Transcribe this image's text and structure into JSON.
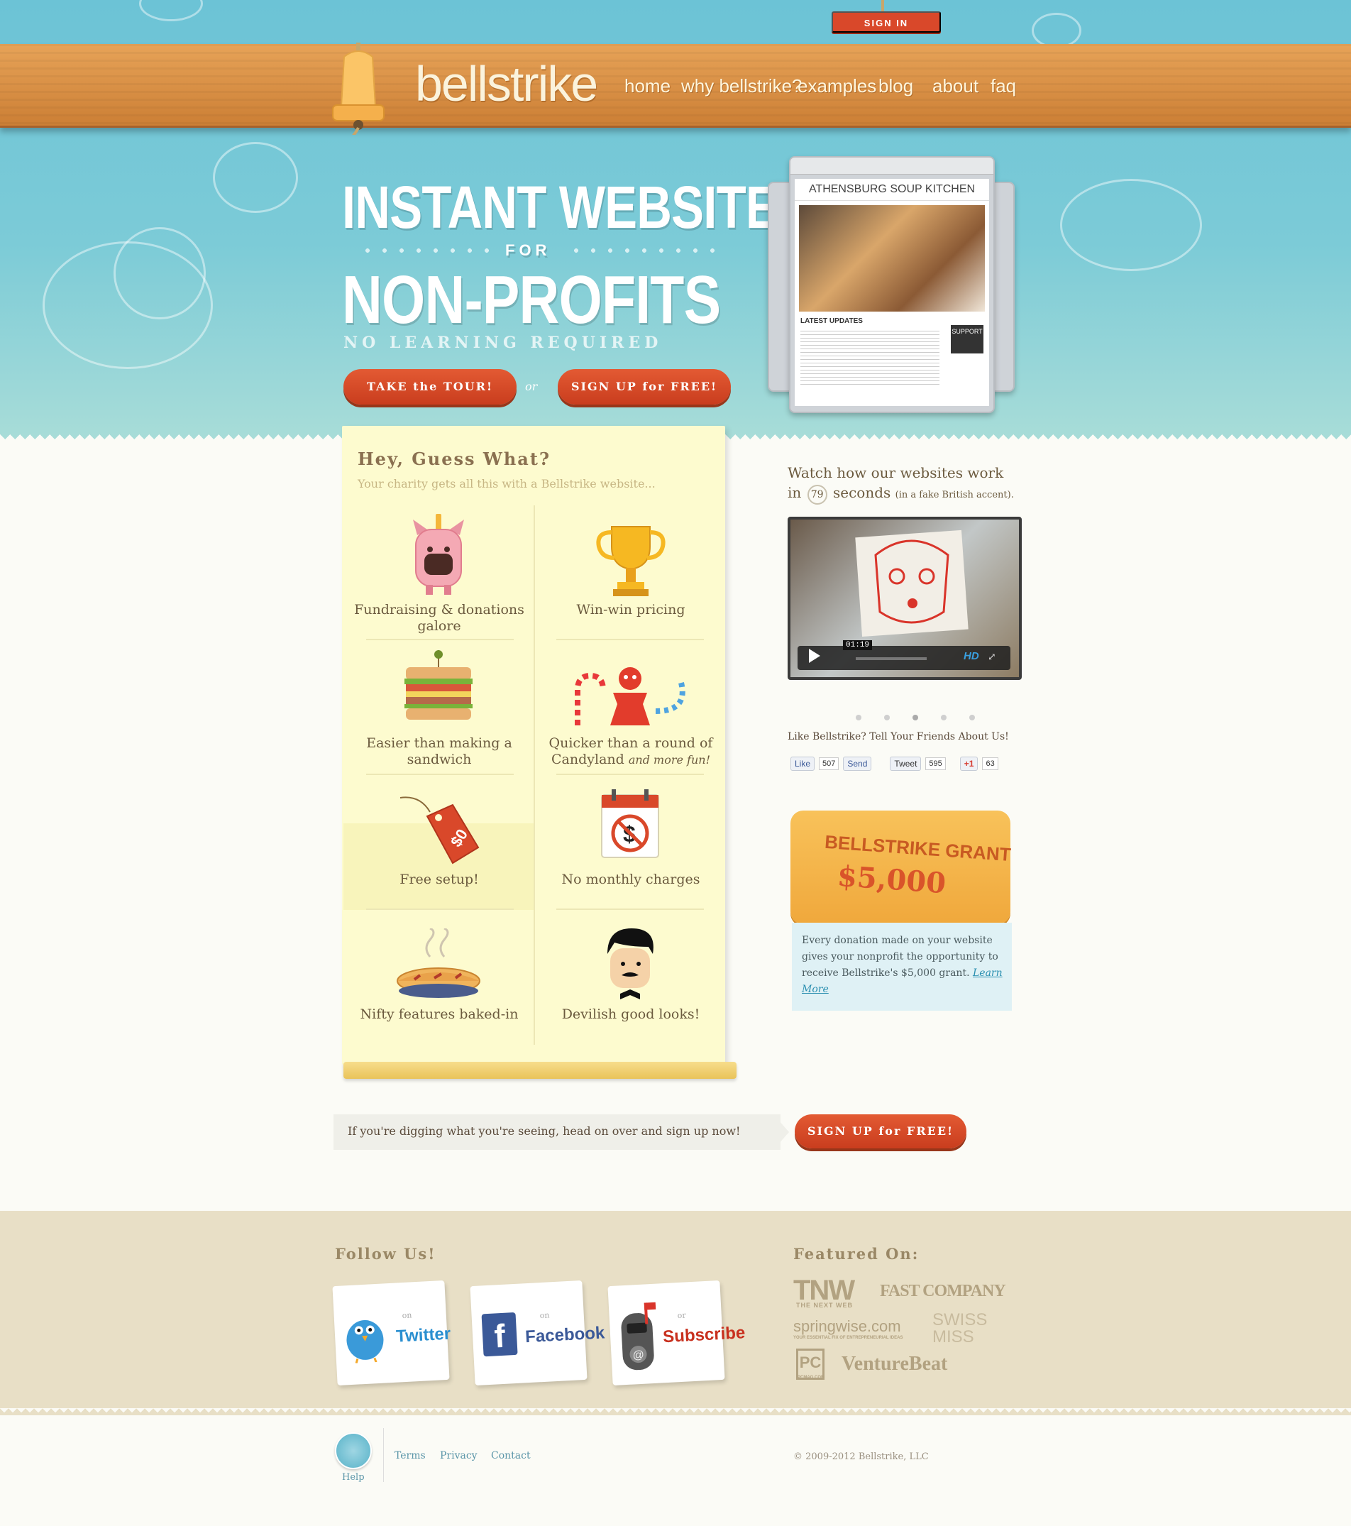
{
  "header": {
    "logo": "bellstrike",
    "nav": [
      "home",
      "why bellstrike?",
      "examples",
      "blog",
      "about",
      "faq"
    ],
    "signin": "SIGN IN"
  },
  "hero": {
    "line1": "INSTANT WEBSITES",
    "for": "FOR",
    "line2": "NON-PROFITS",
    "sub": "NO LEARNING REQUIRED",
    "tour_btn": "TAKE the TOUR!",
    "or": "or",
    "signup_btn": "SIGN UP for FREE!"
  },
  "mock": {
    "title": "ATHENSBURG SOUP KITCHEN",
    "section": "LATEST UPDATES",
    "support": "SUPPORT"
  },
  "features": {
    "title": "Hey, Guess What?",
    "subtitle": "Your charity gets all this with a Bellstrike website...",
    "items": [
      {
        "label": "Fundraising & donations galore",
        "icon": "piggy-bank-icon"
      },
      {
        "label": "Win-win pricing",
        "icon": "trophy-icon"
      },
      {
        "label": "Easier than making a sandwich",
        "icon": "sandwich-icon"
      },
      {
        "label": "Quicker than a round of Candyland",
        "suffix": "and more fun!",
        "icon": "candy-icon"
      },
      {
        "label": "Free setup!",
        "icon": "price-tag-icon"
      },
      {
        "label": "No monthly charges",
        "icon": "no-dollar-calendar-icon"
      },
      {
        "label": "Nifty features baked-in",
        "icon": "pie-icon"
      },
      {
        "label": "Devilish good looks!",
        "icon": "gentleman-icon"
      }
    ]
  },
  "video": {
    "line1": "Watch how our websites work",
    "in": "in",
    "seconds_num": "79",
    "seconds": "seconds",
    "note": "(in a fake British accent).",
    "time": "01:19",
    "hd": "HD"
  },
  "social": {
    "heading": "Like Bellstrike? Tell Your Friends About Us!",
    "like": "Like",
    "like_count": "507",
    "send": "Send",
    "tweet": "Tweet",
    "tweet_count": "595",
    "plus": "+1",
    "plus_count": "63"
  },
  "grant": {
    "title": "BELLSTRIKE GRANT",
    "amount": "$5,000",
    "text": "Every donation made on your website gives your nonprofit the opportunity to receive Bellstrike's $5,000 grant.",
    "link": "Learn More"
  },
  "cta": {
    "text": "If you're digging what you're seeing, head on over and sign up now!",
    "button": "SIGN UP for FREE!"
  },
  "follow": {
    "title": "Follow Us!",
    "on": "on",
    "twitter": "Twitter",
    "facebook": "Facebook",
    "subscribe": "Subscribe",
    "or": "or"
  },
  "featured": {
    "title": "Featured On:",
    "tnw": "TNW",
    "tnw_sub": "THE NEXT WEB",
    "fastco": "FAST COMPANY",
    "springwise": "springwise.com",
    "springwise_sub": "YOUR ESSENTIAL FIX OF ENTREPRENEURIAL IDEAS",
    "swissmiss": "SWISS MISS",
    "pc": "PC",
    "pc_sub": "PCMAG.COM",
    "venturebeat": "VentureBeat"
  },
  "footer": {
    "help": "Help",
    "terms": "Terms",
    "privacy": "Privacy",
    "contact": "Contact",
    "copyright": "© 2009-2012 Bellstrike, LLC"
  },
  "colors": {
    "sky": "#6cc3d6",
    "wood": "#d98c40",
    "accent": "#d9482a",
    "panel": "#fdfbcf"
  }
}
